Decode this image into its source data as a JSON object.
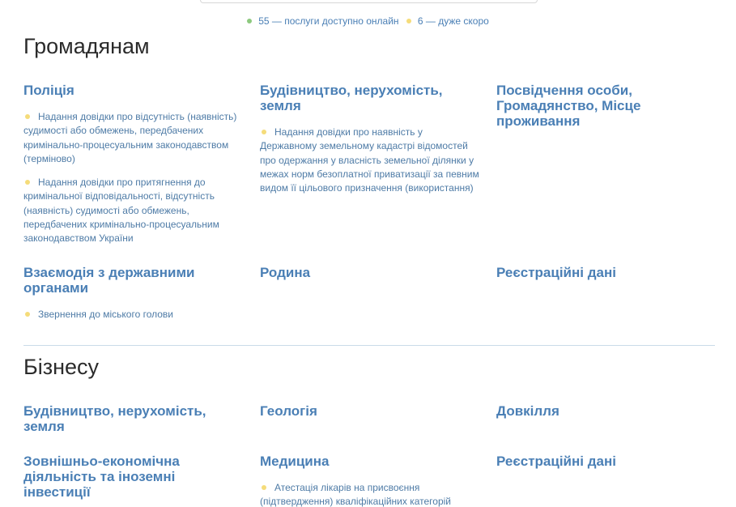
{
  "legend": {
    "online_text": "55 — послуги доступно онлайн",
    "soon_text": "6 — дуже скоро",
    "online_color": "#8dc97e",
    "soon_color": "#f5dc7a"
  },
  "sections": {
    "citizens": {
      "title": "Громадянам",
      "categories": [
        {
          "title": "Поліція",
          "services": [
            "Надання довідки про відсутність (наявність) судимості або обмежень, передбачених кримінально-процесуальним законодавством (терміново)",
            "Надання довідки про притягнення до кримінальної відповідальності, відсутність (наявність) судимості або обмежень, передбачених кримінально-процесуальним законодавством України"
          ]
        },
        {
          "title": "Будівництво, нерухомість, земля",
          "services": [
            "Надання довідки про наявність у Державному земельному кадастрі відомостей про одержання у власність земельної ділянки у межах норм безоплатної приватизації за певним видом її цільового призначення (використання)"
          ]
        },
        {
          "title": "Посвідчення особи, Громадянство, Місце проживання",
          "services": []
        },
        {
          "title": "Взаємодія з державними органами",
          "services": [
            "Звернення до міського голови"
          ]
        },
        {
          "title": "Родина",
          "services": []
        },
        {
          "title": "Реєстраційні дані",
          "services": []
        }
      ]
    },
    "business": {
      "title": "Бізнесу",
      "categories": [
        {
          "title": "Будівництво, нерухомість, земля",
          "services": []
        },
        {
          "title": "Геологія",
          "services": []
        },
        {
          "title": "Довкілля",
          "services": []
        },
        {
          "title": "Зовнішньо-економічна діяльність та іноземні інвестиції",
          "services": []
        },
        {
          "title": "Медицина",
          "services": [
            "Атестація лікарів на присвоєння (підтвердження) кваліфікаційних категорій"
          ]
        },
        {
          "title": "Реєстраційні дані",
          "services": []
        }
      ]
    }
  }
}
